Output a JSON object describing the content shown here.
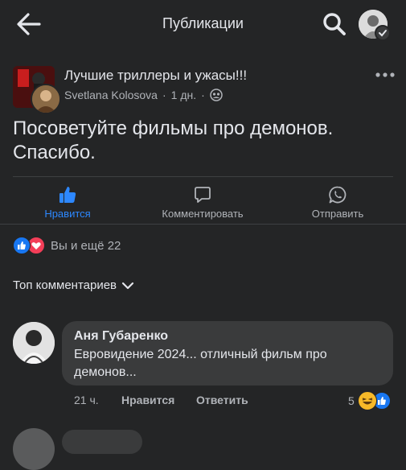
{
  "header": {
    "title": "Публикации",
    "back_icon": "arrow-left-icon",
    "search_icon": "search-icon"
  },
  "post": {
    "group_name": "Лучшие триллеры и ужасы!!!",
    "author": "Svetlana Kolosova",
    "time": "1 дн.",
    "separator": "·",
    "privacy_icon": "group-privacy-icon",
    "text": "Посоветуйте фильмы про демонов. Спасибо."
  },
  "actions": {
    "like": "Нравится",
    "comment": "Комментировать",
    "share": "Отправить"
  },
  "reactions": {
    "summary": "Вы и ещё 22",
    "types": [
      "like",
      "love"
    ]
  },
  "comments": {
    "sort_label": "Топ комментариев",
    "items": [
      {
        "name": "Аня Губаренко",
        "text": "Евровидение 2024... отличный фильм про демонов...",
        "time": "21 ч.",
        "like_label": "Нравится",
        "reply_label": "Ответить",
        "reaction_count": "5",
        "reaction_types": [
          "haha",
          "like"
        ]
      }
    ]
  },
  "colors": {
    "background": "#242526",
    "accent": "#2d88ff",
    "bubble": "#3a3b3c",
    "secondary_text": "#b0b3b8"
  }
}
